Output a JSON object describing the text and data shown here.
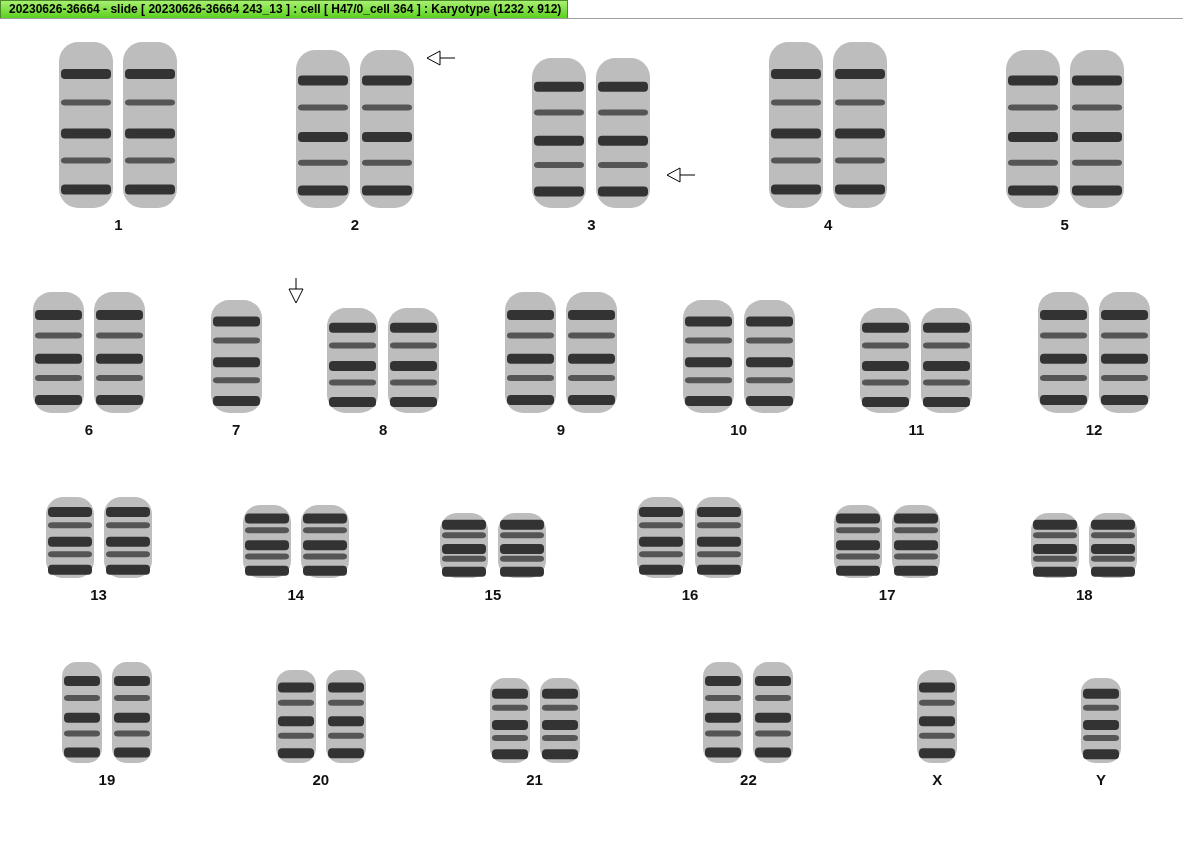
{
  "window": {
    "title": "20230626-36664 - slide [ 20230626-36664 243_13 ] : cell [ H47/0_cell 364 ] : Karyotype  (1232 x 912)"
  },
  "rows": [
    {
      "groups": [
        {
          "label": "1",
          "kind": "pair"
        },
        {
          "label": "2",
          "kind": "pair",
          "pointer_top": true
        },
        {
          "label": "3",
          "kind": "pair",
          "pointer_bottom": true
        },
        {
          "label": "4",
          "kind": "pair"
        },
        {
          "label": "5",
          "kind": "pair"
        }
      ]
    },
    {
      "groups": [
        {
          "label": "6",
          "kind": "pair"
        },
        {
          "label": "7",
          "kind": "single",
          "pointer_above": true
        },
        {
          "label": "8",
          "kind": "pair"
        },
        {
          "label": "9",
          "kind": "pair"
        },
        {
          "label": "10",
          "kind": "pair"
        },
        {
          "label": "11",
          "kind": "pair"
        },
        {
          "label": "12",
          "kind": "pair"
        }
      ]
    },
    {
      "groups": [
        {
          "label": "13",
          "kind": "pair"
        },
        {
          "label": "14",
          "kind": "pair"
        },
        {
          "label": "15",
          "kind": "pair"
        },
        {
          "label": "16",
          "kind": "pair"
        },
        {
          "label": "17",
          "kind": "pair"
        },
        {
          "label": "18",
          "kind": "pair"
        }
      ]
    },
    {
      "groups": [
        {
          "label": "19",
          "kind": "pair"
        },
        {
          "label": "20",
          "kind": "pair"
        },
        {
          "label": "21",
          "kind": "pair"
        },
        {
          "label": "22",
          "kind": "pair"
        },
        {
          "label": "X",
          "kind": "single"
        },
        {
          "label": "Y",
          "kind": "single"
        }
      ]
    }
  ]
}
